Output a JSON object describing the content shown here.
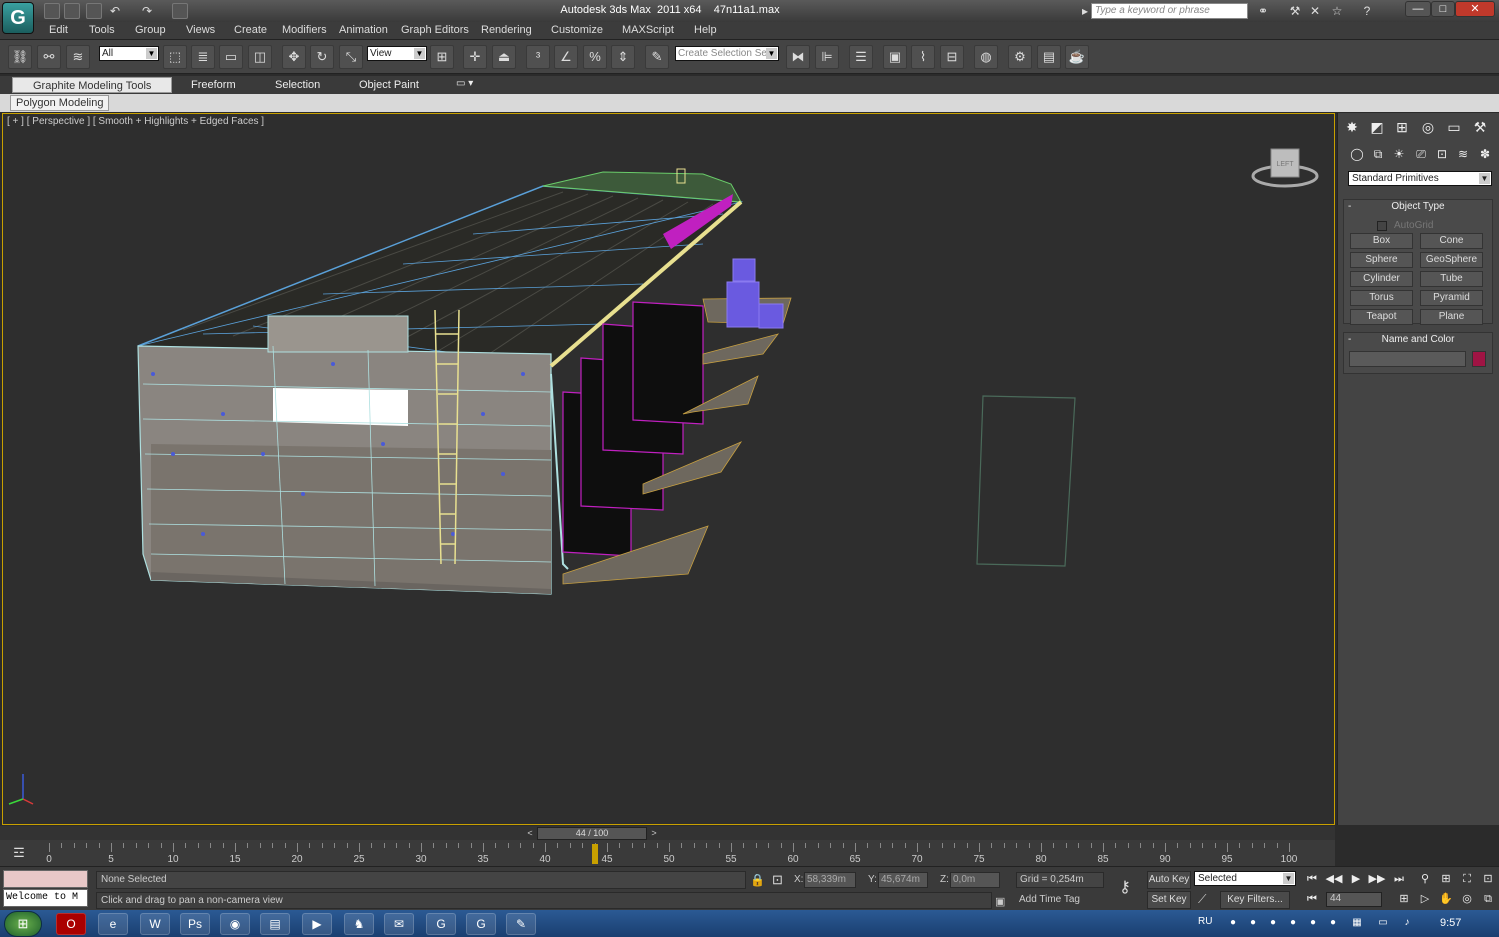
{
  "window": {
    "title": "Autodesk 3ds Max  2011 x64",
    "filename": "47n11a1.max",
    "search_placeholder": "Type a keyword or phrase",
    "app_icon": "3ds-max-logo-icon"
  },
  "menu": [
    "Edit",
    "Tools",
    "Group",
    "Views",
    "Create",
    "Modifiers",
    "Animation",
    "Graph Editors",
    "Rendering",
    "Customize",
    "MAXScript",
    "Help"
  ],
  "main_toolbar": {
    "selection_filter": "All",
    "ref_coord": "View",
    "named_selection_placeholder": "Create Selection Se"
  },
  "ribbon": {
    "tabs": [
      "Graphite Modeling Tools",
      "Freeform",
      "Selection",
      "Object Paint"
    ],
    "active_tab": "Graphite Modeling Tools",
    "sub_label": "Polygon Modeling"
  },
  "viewport": {
    "label": "[ + ] [ Perspective ] [ Smooth + Highlights + Edged Faces ]",
    "viewcube_face": "LEFT",
    "accent": "#c8a000"
  },
  "command_panel": {
    "category": "Standard Primitives",
    "object_type_title": "Object Type",
    "autogrid_label": "AutoGrid",
    "buttons": [
      "Box",
      "Cone",
      "Sphere",
      "GeoSphere",
      "Cylinder",
      "Tube",
      "Torus",
      "Pyramid",
      "Teapot",
      "Plane"
    ],
    "name_color_title": "Name and Color",
    "object_color": "#a01444"
  },
  "time_slider": {
    "label": "44 / 100",
    "current_frame": 44,
    "total_frames": 100,
    "ticks": [
      0,
      5,
      10,
      15,
      20,
      25,
      30,
      35,
      40,
      45,
      50,
      55,
      60,
      65,
      70,
      75,
      80,
      85,
      90,
      95,
      100
    ]
  },
  "status": {
    "maxscript_text": "Welcome to M",
    "selection": "None Selected",
    "prompt": "Click and drag to pan a non-camera view",
    "x_label": "X:",
    "x_value": "58,339m",
    "y_label": "Y:",
    "y_value": "45,674m",
    "z_label": "Z:",
    "z_value": "0,0m",
    "grid": "Grid = 0,254m",
    "add_time_tag": "Add Time Tag",
    "auto_key": "Auto Key",
    "set_key": "Set Key",
    "key_mode": "Selected",
    "key_filters": "Key Filters...",
    "frame_value": "44"
  },
  "taskbar": {
    "language": "RU",
    "clock": "9:57"
  }
}
